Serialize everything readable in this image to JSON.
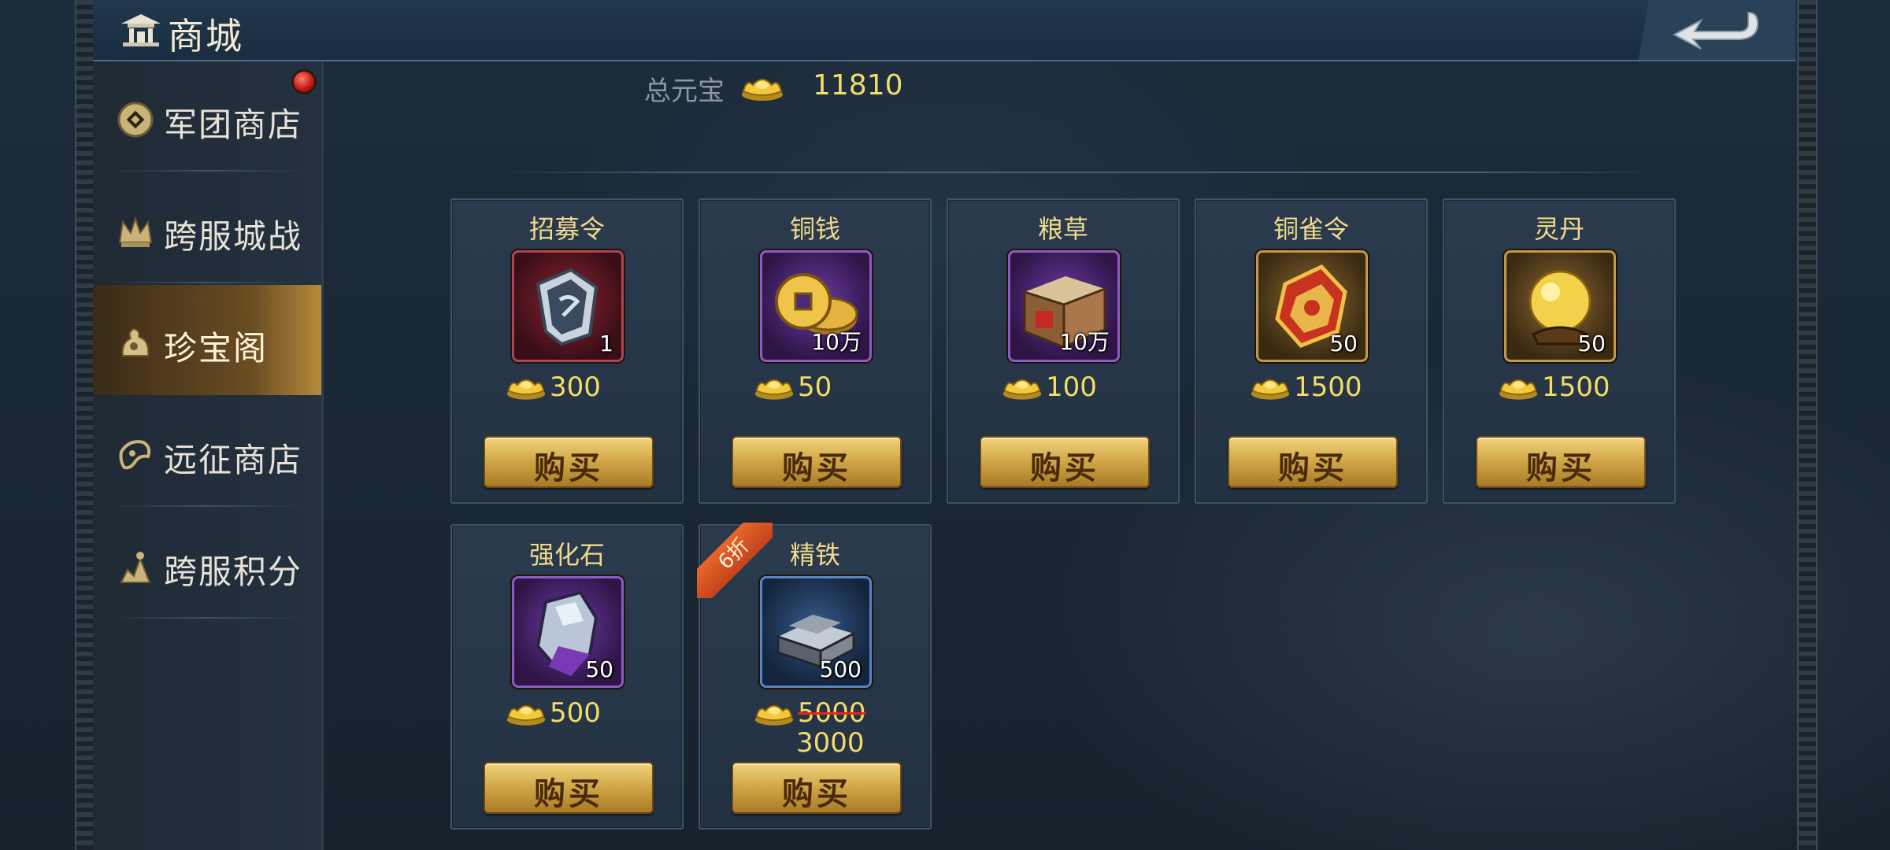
{
  "header": {
    "title": "商城"
  },
  "sidebar": {
    "items": [
      {
        "label": "军团商店",
        "active": false,
        "icon": "coin-icon"
      },
      {
        "label": "跨服城战",
        "active": false,
        "icon": "crown-icon"
      },
      {
        "label": "珍宝阁",
        "active": true,
        "icon": "treasure-icon"
      },
      {
        "label": "远征商店",
        "active": false,
        "icon": "horn-icon"
      },
      {
        "label": "跨服积分",
        "active": false,
        "icon": "trophy-icon"
      }
    ],
    "notification": true
  },
  "summary": {
    "label": "总元宝",
    "value": "11810",
    "icon": "gold-ingot-icon"
  },
  "products": [
    {
      "name": "招募令",
      "qty": "1",
      "price": "300",
      "buy_label": "购买",
      "icon": "recruit-token-icon",
      "frame": "red"
    },
    {
      "name": "铜钱",
      "qty": "10万",
      "price": "50",
      "buy_label": "购买",
      "icon": "copper-coins-icon",
      "frame": "purple"
    },
    {
      "name": "粮草",
      "qty": "10万",
      "price": "100",
      "buy_label": "购买",
      "icon": "grain-crate-icon",
      "frame": "purple"
    },
    {
      "name": "铜雀令",
      "qty": "50",
      "price": "1500",
      "buy_label": "购买",
      "icon": "bronze-sparrow-token-icon",
      "frame": "gold"
    },
    {
      "name": "灵丹",
      "qty": "50",
      "price": "1500",
      "buy_label": "购买",
      "icon": "elixir-orb-icon",
      "frame": "gold"
    },
    {
      "name": "强化石",
      "qty": "50",
      "price": "500",
      "buy_label": "购买",
      "icon": "enhance-stone-icon",
      "frame": "purple"
    },
    {
      "name": "精铁",
      "qty": "500",
      "price": "5000",
      "price_new": "3000",
      "discount": "6折",
      "buy_label": "购买",
      "icon": "refined-iron-icon",
      "frame": "blue"
    }
  ],
  "colors": {
    "price": "#f4dc6a",
    "title": "#f1d98c",
    "button": "#d3a94a",
    "discount": "#e8672a"
  }
}
